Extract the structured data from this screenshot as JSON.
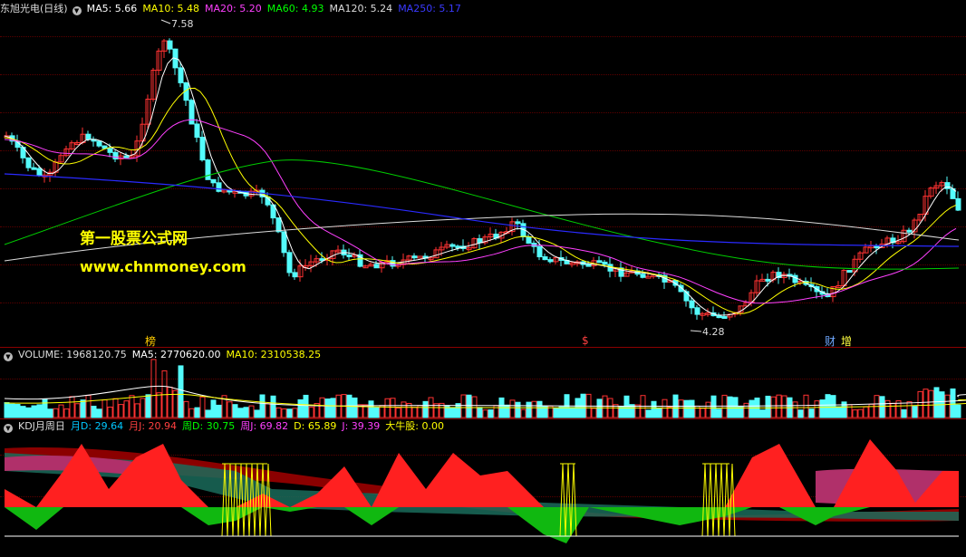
{
  "price_panel": {
    "title": "东旭光电(日线)",
    "ma": [
      {
        "label": "MA5: 5.66",
        "color": "#ffffff"
      },
      {
        "label": "MA10: 5.48",
        "color": "#ffff00"
      },
      {
        "label": "MA20: 5.20",
        "color": "#ff40ff"
      },
      {
        "label": "MA60: 4.93",
        "color": "#00ff00"
      },
      {
        "label": "MA120: 5.24",
        "color": "#dddddd"
      },
      {
        "label": "MA250: 5.17",
        "color": "#3a3aff"
      }
    ],
    "high_label": "7.58",
    "low_label": "4.28",
    "markers": [
      {
        "text": "榜",
        "color": "#ffcc00"
      },
      {
        "text": "$",
        "color": "#ff4040"
      },
      {
        "text": "财",
        "color": "#6fa8ff"
      },
      {
        "text": "增",
        "color": "#ffff40"
      }
    ]
  },
  "watermark": {
    "line1": "第一股票公式网",
    "line2": "www.chnmoney.com"
  },
  "volume_panel": {
    "items": [
      {
        "label": "VOLUME: 1968120.75",
        "color": "#dddddd"
      },
      {
        "label": "MA5: 2770620.00",
        "color": "#ffffff"
      },
      {
        "label": "MA10: 2310538.25",
        "color": "#ffff00"
      }
    ]
  },
  "kdj_panel": {
    "items": [
      {
        "label": "KDJ月周日",
        "color": "#dddddd"
      },
      {
        "label": "月D: 29.64",
        "color": "#00c8ff"
      },
      {
        "label": "月J: 20.94",
        "color": "#ff4040"
      },
      {
        "label": "周D: 30.75",
        "color": "#00ff00"
      },
      {
        "label": "周J: 69.82",
        "color": "#ff40ff"
      },
      {
        "label": "D: 65.89",
        "color": "#ffff00"
      },
      {
        "label": "J: 39.39",
        "color": "#ff40ff"
      },
      {
        "label": "大牛股: 0.00",
        "color": "#ffff00"
      }
    ]
  },
  "colors": {
    "up": "#ff3232",
    "down": "#54fcfc",
    "border": "#8b0000"
  }
}
